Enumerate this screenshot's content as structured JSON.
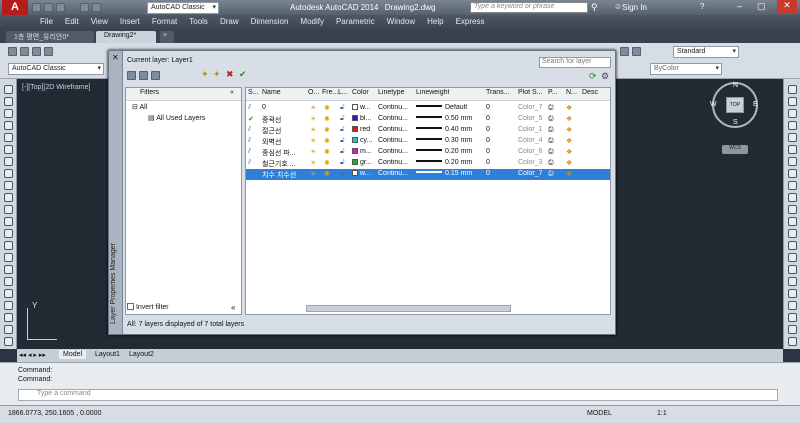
{
  "app": {
    "title": "Autodesk AutoCAD 2014",
    "document": "Drawing2.dwg",
    "search_placeholder": "Type a keyword or phrase",
    "sign_in": "Sign In",
    "workspace": "AutoCAD Classic"
  },
  "menu": [
    "File",
    "Edit",
    "View",
    "Insert",
    "Format",
    "Tools",
    "Draw",
    "Dimension",
    "Modify",
    "Parametric",
    "Window",
    "Help",
    "Express"
  ],
  "tabs": [
    "1층 평면_유리안0*",
    "Drawing2*"
  ],
  "toolbar": {
    "workspace_combo": "AutoCAD Classic",
    "style_combo": "Standard",
    "bylayer": "ByColor"
  },
  "canvas": {
    "view_label": "[-][Top][2D Wireframe]",
    "compass": {
      "n": "N",
      "s": "S",
      "e": "E",
      "w": "W",
      "top": "TOP",
      "wcs": "WCS"
    },
    "axis_y": "Y"
  },
  "palette": {
    "current_layer": "Current layer: Layer1",
    "search_placeholder": "Search for layer",
    "side_label": "Layer Properties Manager",
    "filters": {
      "title": "Filters",
      "all": "All",
      "all_used": "All Used Layers",
      "invert": "Invert filter"
    },
    "columns": [
      "S...",
      "Name",
      "O...",
      "Fre...",
      "L...",
      "Color",
      "Linetype",
      "Lineweight",
      "Trans...",
      "Plot S...",
      "P...",
      "N...",
      "Desc"
    ],
    "layers": [
      {
        "name": "0",
        "color_name": "w...",
        "color": "#ffffff",
        "linetype": "Continu...",
        "lineweight": "Default",
        "trans": "0",
        "plot": "Color_7",
        "current": false,
        "selected": false
      },
      {
        "name": "중곽선",
        "color_name": "bl...",
        "color": "#1a1ae0",
        "linetype": "Continu...",
        "lineweight": "0.50 mm",
        "trans": "0",
        "plot": "Color_5",
        "current": true,
        "selected": false
      },
      {
        "name": "절근선",
        "color_name": "red",
        "color": "#e01a1a",
        "linetype": "Continu...",
        "lineweight": "0.40 mm",
        "trans": "0",
        "plot": "Color_1",
        "current": false,
        "selected": false
      },
      {
        "name": "외벽선",
        "color_name": "cy...",
        "color": "#16c8c8",
        "linetype": "Continu...",
        "lineweight": "0.30 mm",
        "trans": "0",
        "plot": "Color_4",
        "current": false,
        "selected": false
      },
      {
        "name": "중심선 파...",
        "color_name": "m...",
        "color": "#d21ad2",
        "linetype": "Continu...",
        "lineweight": "0.20 mm",
        "trans": "0",
        "plot": "Color_6",
        "current": false,
        "selected": false
      },
      {
        "name": "철근기호 ...",
        "color_name": "gr...",
        "color": "#20b020",
        "linetype": "Continu...",
        "lineweight": "0.20 mm",
        "trans": "0",
        "plot": "Color_3",
        "current": false,
        "selected": false
      },
      {
        "name": "치수 치수선",
        "color_name": "w...",
        "color": "#ffffff",
        "linetype": "Continu...",
        "lineweight": "0.15 mm",
        "trans": "0",
        "plot": "Color_7",
        "current": false,
        "selected": true
      }
    ],
    "footer": "All: 7 layers displayed of 7 total layers"
  },
  "layout_tabs": [
    "Model",
    "Layout1",
    "Layout2"
  ],
  "command": {
    "lines": [
      "Command:",
      "Command:"
    ],
    "prompt": "Type a command"
  },
  "status": {
    "coords": "1866.0773, 250.1605 , 0.0000",
    "model": "MODEL",
    "scale": "1:1"
  }
}
